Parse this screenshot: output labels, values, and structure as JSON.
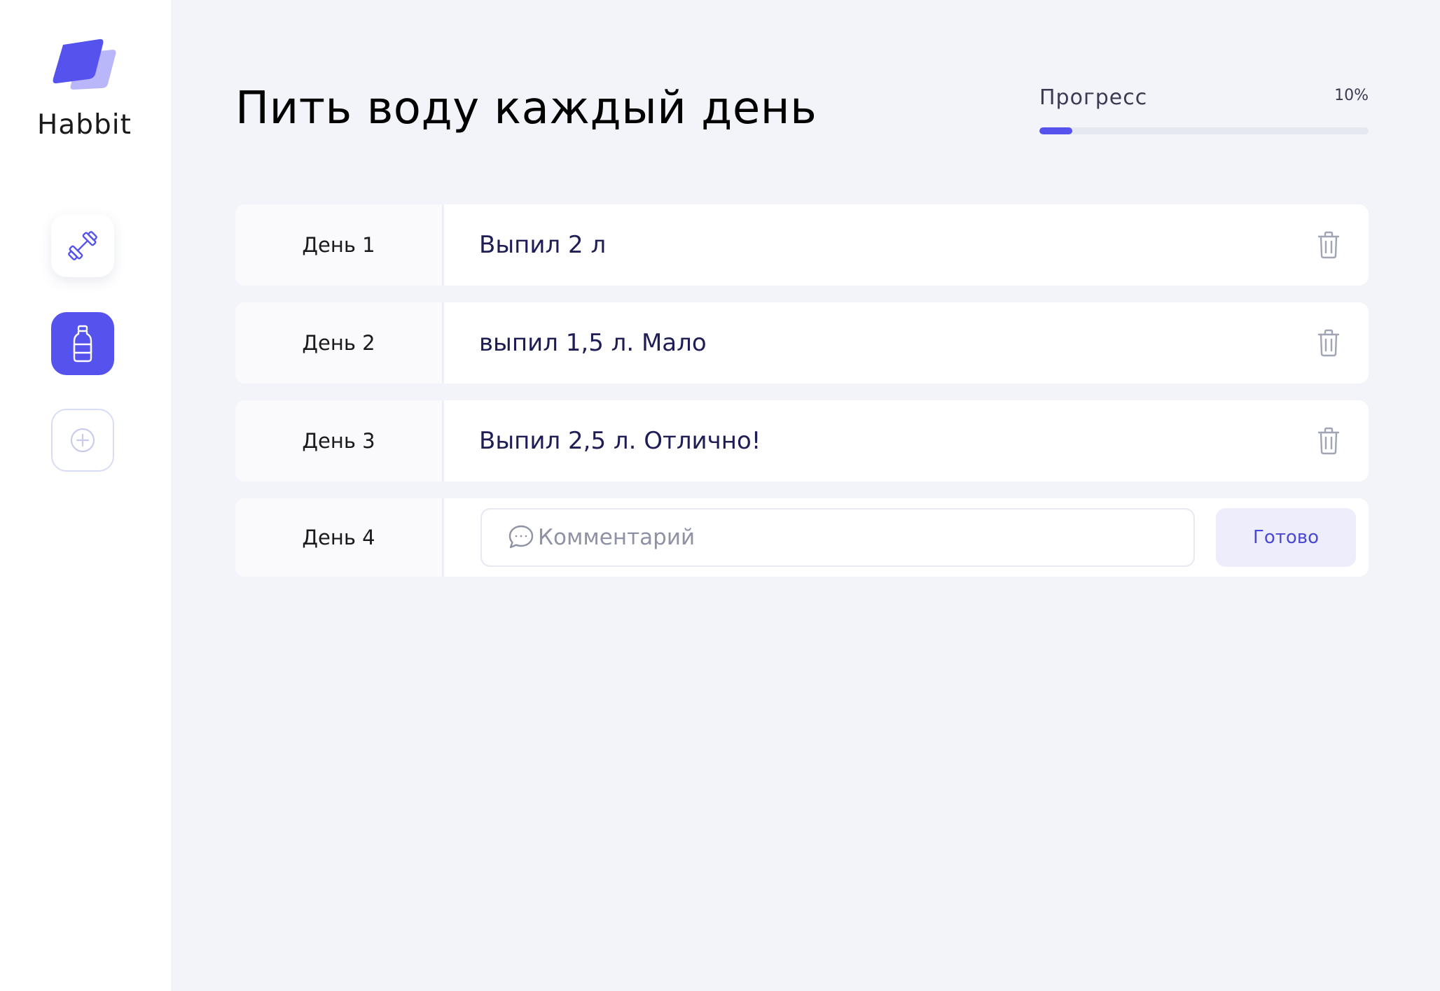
{
  "app": {
    "name": "Habbit"
  },
  "sidebar": {
    "items": [
      {
        "icon": "dumbbell-icon",
        "active": false
      },
      {
        "icon": "bottle-icon",
        "active": true
      },
      {
        "icon": "plus-circle-icon",
        "active": false
      }
    ]
  },
  "habit": {
    "title": "Пить воду каждый день",
    "progress_label": "Прогресс",
    "progress_value": "10%",
    "progress_fraction": 0.1
  },
  "entries": [
    {
      "day": "День 1",
      "comment": "Выпил 2 л"
    },
    {
      "day": "День 2",
      "comment": "выпил 1,5 л. Мало"
    },
    {
      "day": "День 3",
      "comment": "Выпил 2,5 л. Отлично!"
    }
  ],
  "new_entry": {
    "day": "День 4",
    "placeholder": "Комментарий",
    "value": "",
    "submit_label": "Готово"
  },
  "colors": {
    "accent": "#5552EE",
    "background": "#F3F4FA",
    "text_dark": "#1F1D55"
  }
}
